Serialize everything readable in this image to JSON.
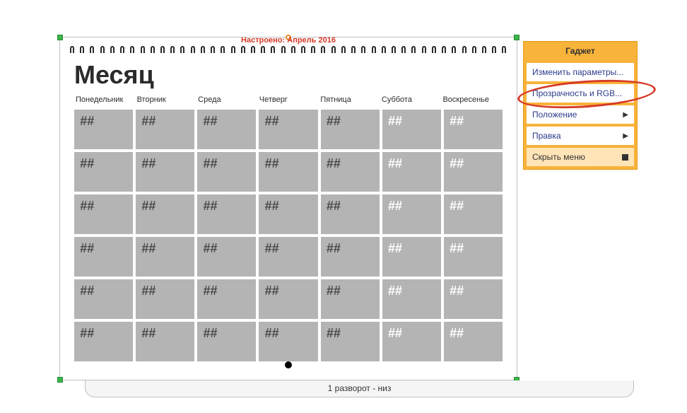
{
  "top_label": "Настроено: Апрель 2016",
  "calendar": {
    "title": "Месяц",
    "days": [
      "Понедельник",
      "Вторник",
      "Среда",
      "Четверг",
      "Пятница",
      "Суббота",
      "Воскресенье"
    ],
    "placeholder": "##",
    "rows": 6,
    "cols": 7
  },
  "bottom_tab": "1 разворот - низ",
  "gadget": {
    "title": "Гаджет",
    "items": [
      {
        "label": "Изменить параметры...",
        "type": "plain"
      },
      {
        "label": "Прозрачность и RGB...",
        "type": "plain",
        "highlighted": true
      },
      {
        "label": "Положение",
        "type": "submenu"
      },
      {
        "label": "Правка",
        "type": "submenu"
      },
      {
        "label": "Скрыть меню",
        "type": "hide"
      }
    ]
  }
}
